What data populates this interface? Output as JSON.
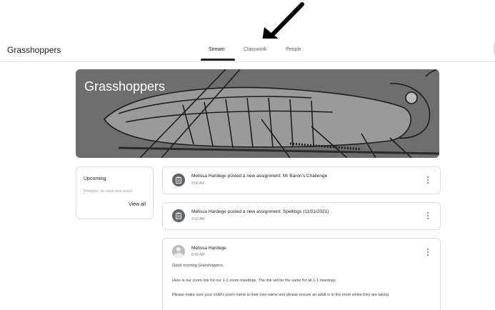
{
  "header": {
    "class_name": "Grasshoppers",
    "tabs": [
      {
        "label": "Stream",
        "active": true
      },
      {
        "label": "Classwork",
        "active": false
      },
      {
        "label": "People",
        "active": false
      }
    ]
  },
  "banner": {
    "title": "Grasshoppers",
    "background": "#6e6e6e"
  },
  "upcoming": {
    "title": "Upcoming",
    "empty_text": "Woohoo, no work due soon!",
    "view_all": "View all"
  },
  "stream": {
    "assignments": [
      {
        "icon": "assignment-icon",
        "text": "Melissa Hardege posted a new assignment: Mr Baron's Challenge",
        "time": "9:58 AM"
      },
      {
        "icon": "assignment-icon",
        "text": "Melissa Hardege posted a new assignment: Spellings (11/01/2021)",
        "time": "9:02 AM"
      }
    ],
    "announcement": {
      "author": "Melissa Hardege",
      "time": "8:49 AM",
      "lines": [
        "Good morning Grasshoppers,",
        "Here is our zoom link for our 1-1 zoom meetings. The link will be the same for all 1-1 meetings.",
        "Please make sure your child's zoom name is their own name and please ensure an adult is in the room whilst they are taking"
      ]
    }
  },
  "colors": {
    "text": "#202124",
    "muted": "#5f6368",
    "border": "#dadce0"
  }
}
